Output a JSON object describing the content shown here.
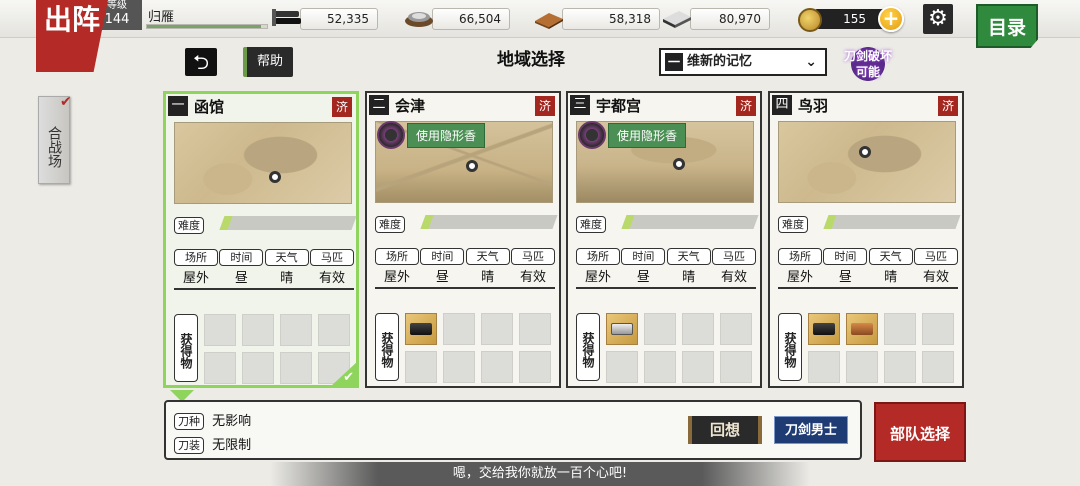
{
  "header": {
    "sortie_label": "出阵",
    "level_label": "等级",
    "level": "144",
    "player_name": "归雁",
    "xp_fraction": 0.95,
    "resources": [
      {
        "name": "charcoal",
        "icon": "charcoal-icon",
        "value": "52,335"
      },
      {
        "name": "jewel-steel",
        "icon": "jewel-steel-icon",
        "value": "66,504"
      },
      {
        "name": "cooling-material",
        "icon": "cooling-material-icon",
        "value": "58,318"
      },
      {
        "name": "whetstone",
        "icon": "whetstone-icon",
        "value": "80,970"
      }
    ],
    "koban": "155",
    "menu_label": "目录"
  },
  "side_tab": {
    "label": "合战场"
  },
  "toolbar": {
    "help_label": "帮助",
    "title": "地域选择",
    "era_number": "一",
    "era_name": "维新的记忆",
    "break_line1": "刀剑破坏",
    "break_line2": "可能"
  },
  "labels": {
    "difficulty": "难度",
    "location": "场所",
    "time": "时间",
    "weather": "天气",
    "horse": "马匹",
    "loot": "获得物",
    "cleared": "济",
    "incense": "使用隐形香"
  },
  "areas": [
    {
      "num": "一",
      "name": "函馆",
      "location": "屋外",
      "time": "昼",
      "weather": "晴",
      "horse": "有效",
      "difficulty": 0.06,
      "selected": true,
      "loot": []
    },
    {
      "num": "二",
      "name": "会津",
      "location": "屋外",
      "time": "昼",
      "weather": "晴",
      "horse": "有效",
      "difficulty": 0.06,
      "loot": [
        "charcoal"
      ]
    },
    {
      "num": "三",
      "name": "宇都宫",
      "location": "屋外",
      "time": "昼",
      "weather": "晴",
      "horse": "有效",
      "difficulty": 0.06,
      "loot": [
        "steel"
      ]
    },
    {
      "num": "四",
      "name": "鸟羽",
      "location": "屋外",
      "time": "昼",
      "weather": "晴",
      "horse": "有效",
      "difficulty": 0.06,
      "loot": [
        "charcoal",
        "whetstone"
      ]
    }
  ],
  "info": {
    "sword_type_label": "刀种",
    "sword_type_value": "无影响",
    "equipment_label": "刀装",
    "equipment_value": "无限制",
    "recall_label": "回想",
    "swords_label": "刀剑男士"
  },
  "squad_label": "部队选择",
  "dialogue": "嗯，交给我你就放一百个心吧!",
  "colors": {
    "accent_red": "#b32a26",
    "selected_green": "#8fd45c",
    "menu_green": "#2f8a3e",
    "swords_blue": "#1e3b74"
  }
}
